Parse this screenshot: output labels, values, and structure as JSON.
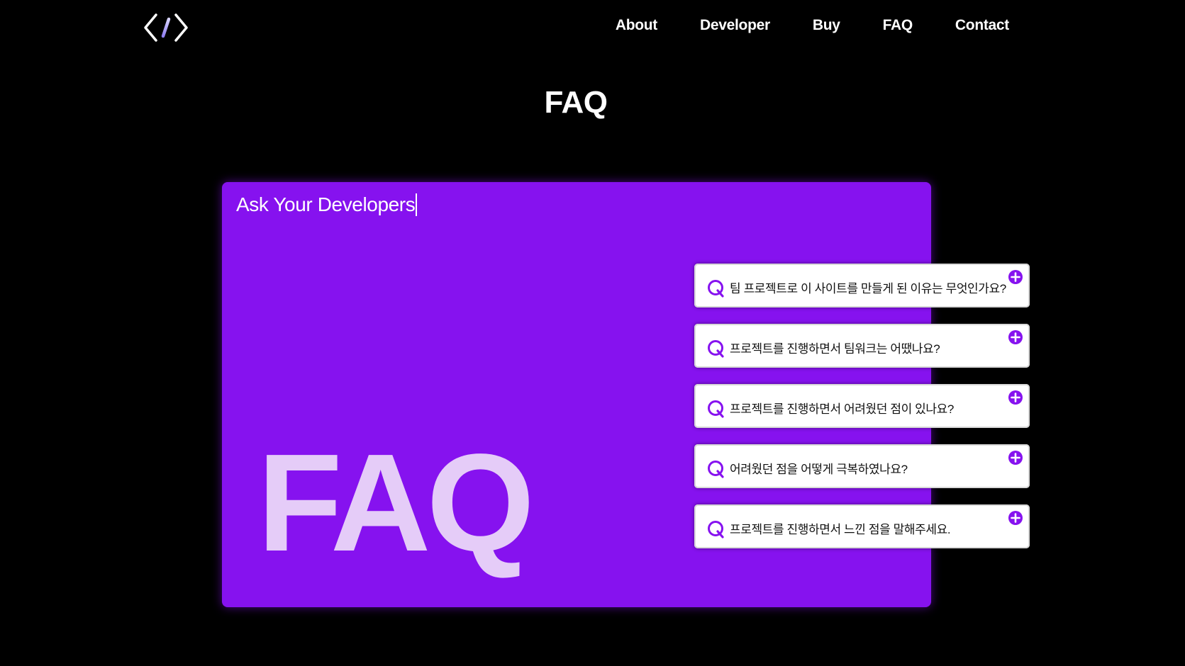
{
  "header": {
    "logo_icon": "code-brackets-icon",
    "nav": [
      "About",
      "Developer",
      "Buy",
      "FAQ",
      "Contact"
    ]
  },
  "page_title": "FAQ",
  "card": {
    "heading": "Ask Your Developers",
    "big_text": "FAQ",
    "background_color": "#8612ef",
    "big_text_color": "#e5ccf8"
  },
  "questions": [
    {
      "prefix_icon": "q-icon",
      "text": "팀 프로젝트로 이 사이트를 만들게 된 이유는 무엇인가요?",
      "toggle_icon": "plus-circle-icon"
    },
    {
      "prefix_icon": "q-icon",
      "text": "프로젝트를 진행하면서 팀워크는 어땠나요?",
      "toggle_icon": "plus-circle-icon"
    },
    {
      "prefix_icon": "q-icon",
      "text": "프로젝트를 진행하면서 어려웠던 점이 있나요?",
      "toggle_icon": "plus-circle-icon"
    },
    {
      "prefix_icon": "q-icon",
      "text": "어려웠던 점을 어떻게 극복하였나요?",
      "toggle_icon": "plus-circle-icon"
    },
    {
      "prefix_icon": "q-icon",
      "text": "프로젝트를 진행하면서 느낀 점을 말해주세요.",
      "toggle_icon": "plus-circle-icon"
    }
  ],
  "colors": {
    "accent": "#8612ef",
    "background": "#000000",
    "text_light": "#ffffff"
  }
}
